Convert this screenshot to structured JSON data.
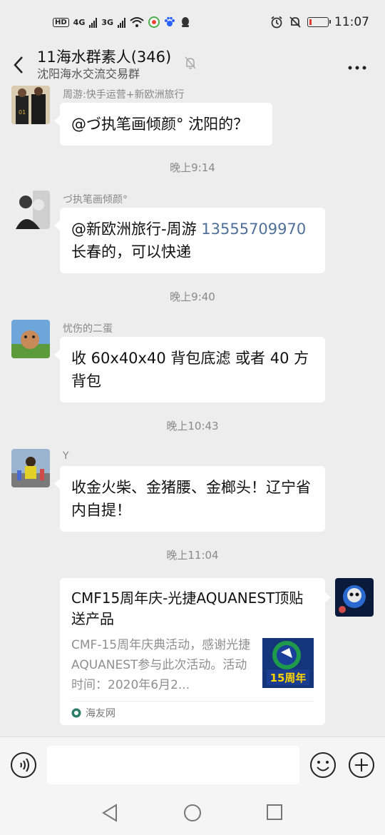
{
  "status_bar": {
    "hd_label": "HD",
    "net1": "4G",
    "net2": "3G",
    "time": "11:07",
    "battery_level": 0.12
  },
  "header": {
    "title": "11海水群素人(346)",
    "subtitle": "沈阳海水交流交易群"
  },
  "messages": [
    {
      "sender": "周游:快手运营+新欧洲旅行",
      "text": "@づ执笔画倾颜° 沈阳的？"
    },
    {
      "time": "晚上9:14"
    },
    {
      "sender": "づ执笔画倾颜°",
      "text_pre": "@新欧洲旅行-周游 ",
      "phone": "13555709970",
      "text_post": "长春的，可以快递"
    },
    {
      "time": "晚上9:40"
    },
    {
      "sender": "忧伤的二蛋",
      "text": "收 60x40x40 背包底滤 或者 40 方背包"
    },
    {
      "time": "晚上10:43"
    },
    {
      "sender": "Y",
      "text": "收金火柴、金猪腰、金榔头！辽宁省内自提！"
    },
    {
      "time": "晚上11:04"
    }
  ],
  "share_card": {
    "title": "CMF15周年庆-光捷AQUANEST顶贴送产品",
    "description": "CMF-15周年庆典活动，感谢光捷AQUANEST参与此次活动。活动时间：2020年6月2...",
    "source": "海友网",
    "thumb_text": "15周年"
  },
  "colors": {
    "background": "#ededed",
    "bubble": "#ffffff",
    "link": "#50709a",
    "battery_low": "#e53935"
  },
  "icons": [
    "back-icon",
    "mute-icon",
    "more-icon",
    "voice-icon",
    "emoji-icon",
    "plus-icon",
    "nav-back-icon",
    "nav-home-icon",
    "nav-recent-icon"
  ]
}
